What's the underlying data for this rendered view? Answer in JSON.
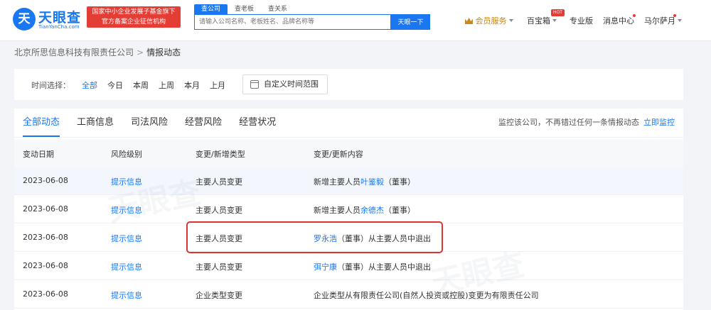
{
  "header": {
    "logo_mark": "天",
    "logo_text": "天眼查",
    "logo_sub": "TianYanCha.com",
    "gov_badge_line1": "国家中小企业发展子基金旗下",
    "gov_badge_line2": "官方备案企业征信机构",
    "search_tabs": [
      "查公司",
      "查老板",
      "查关系"
    ],
    "search_placeholder": "请输入公司名称、老板姓名、品牌名称等",
    "search_button": "天眼一下",
    "member_service": "会员服务",
    "treasure_box": "百宝箱",
    "hot_badge": "HOT",
    "pro_version": "专业版",
    "message_center": "消息中心",
    "user_name": "马尔萨月"
  },
  "breadcrumb": {
    "company": "北京所思信息科技有限责任公司",
    "separator": ">",
    "current": "情报动态"
  },
  "time_filter": {
    "label": "时间选择：",
    "options": [
      "全部",
      "今日",
      "本周",
      "上周",
      "本月",
      "上月"
    ],
    "custom_range": "自定义时间范围"
  },
  "tabs": [
    "全部动态",
    "工商信息",
    "司法风险",
    "经营风险",
    "经营状况"
  ],
  "monitor": {
    "tip": "监控该公司，不再错过任何一条情报动态",
    "link": "立即监控"
  },
  "table": {
    "headers": [
      "变动日期",
      "风险级别",
      "变更/新增类型",
      "变更/更新内容"
    ],
    "rows": [
      {
        "date": "2023-06-08",
        "risk": "提示信息",
        "type": "主要人员变更",
        "content_pre": "新增主要人员",
        "content_link": "叶鉴毅",
        "content_post": "（董事）"
      },
      {
        "date": "2023-06-08",
        "risk": "提示信息",
        "type": "主要人员变更",
        "content_pre": "新增主要人员",
        "content_link": "余德杰",
        "content_post": "（董事）"
      },
      {
        "date": "2023-06-08",
        "risk": "提示信息",
        "type": "主要人员变更",
        "content_pre": "",
        "content_link": "罗永浩",
        "content_post": "（董事）从主要人员中退出"
      },
      {
        "date": "2023-06-08",
        "risk": "提示信息",
        "type": "主要人员变更",
        "content_pre": "",
        "content_link": "弭宁康",
        "content_post": "（董事）从主要人员中退出"
      },
      {
        "date": "2023-06-08",
        "risk": "提示信息",
        "type": "企业类型变更",
        "content_pre": "企业类型从有限责任公司(自然人投资或控股)变更为有限责任公司",
        "content_link": "",
        "content_post": ""
      }
    ]
  },
  "watermark": "天眼查",
  "colors": {
    "brand": "#1a77f2",
    "badge_red": "#e33d36",
    "highlight": "#d9362f"
  }
}
